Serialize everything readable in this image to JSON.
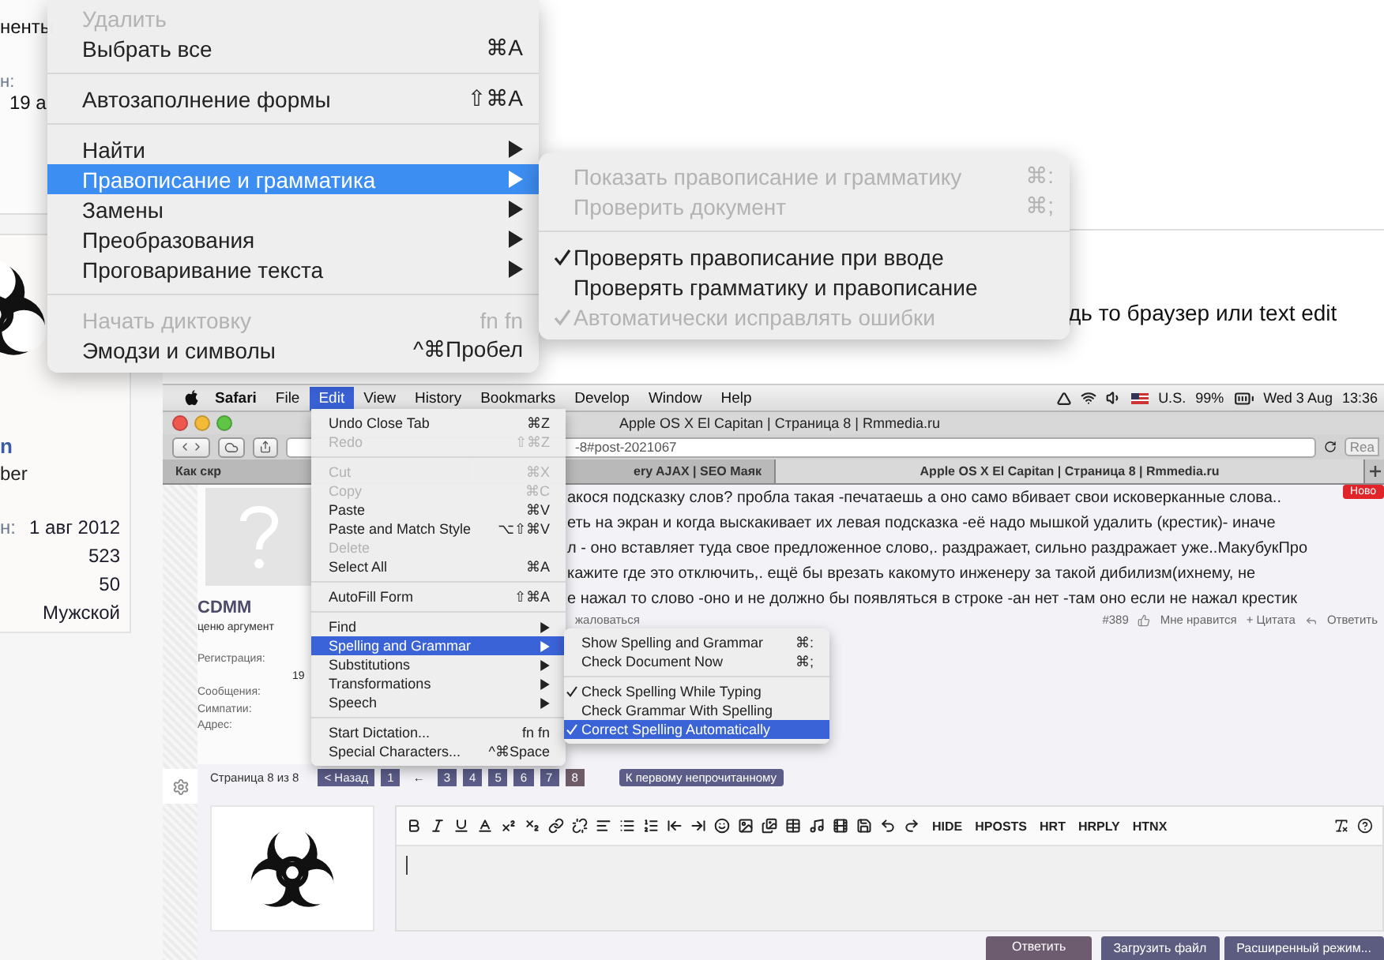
{
  "background_page": {
    "sidebar_fragments": [
      "ненты",
      "н:",
      "19 а"
    ],
    "profile": {
      "name": "n",
      "title": "ber",
      "rows": [
        {
          "label": "н:",
          "value": "1 авг 2012"
        },
        {
          "value": "523"
        },
        {
          "value": "50"
        },
        {
          "value": "Мужской"
        }
      ]
    },
    "post_text": "дь то браузер или text edit"
  },
  "context_menu": {
    "items": [
      {
        "kind": "item",
        "label": "Удалить",
        "disabled": true,
        "selected": false,
        "has_submenu": false
      },
      {
        "kind": "item",
        "label": "Выбрать все",
        "shortcut": "⌘A",
        "disabled": false,
        "selected": false,
        "has_submenu": false
      },
      {
        "kind": "separator"
      },
      {
        "kind": "item",
        "label": "Автозаполнение формы",
        "shortcut": "⇧⌘A",
        "disabled": false,
        "selected": false,
        "has_submenu": false
      },
      {
        "kind": "separator"
      },
      {
        "kind": "item",
        "label": "Найти",
        "disabled": false,
        "selected": false,
        "has_submenu": true
      },
      {
        "kind": "item",
        "label": "Правописание и грамматика",
        "disabled": false,
        "selected": true,
        "has_submenu": true
      },
      {
        "kind": "item",
        "label": "Замены",
        "disabled": false,
        "selected": false,
        "has_submenu": true
      },
      {
        "kind": "item",
        "label": "Преобразования",
        "disabled": false,
        "selected": false,
        "has_submenu": true
      },
      {
        "kind": "item",
        "label": "Проговаривание текста",
        "disabled": false,
        "selected": false,
        "has_submenu": true
      },
      {
        "kind": "separator"
      },
      {
        "kind": "item",
        "label": "Начать диктовку",
        "shortcut": "fn fn",
        "disabled": true,
        "selected": false,
        "has_submenu": false
      },
      {
        "kind": "item",
        "label": "Эмодзи и символы",
        "shortcut": "^⌘Пробел",
        "disabled": false,
        "selected": false,
        "has_submenu": false
      }
    ]
  },
  "submenu": {
    "items": [
      {
        "kind": "item",
        "label": "Показать правописание и грамматику",
        "shortcut": "⌘:",
        "disabled": true,
        "selected": false,
        "checked": false
      },
      {
        "kind": "item",
        "label": "Проверить документ",
        "shortcut": "⌘;",
        "disabled": true,
        "selected": false,
        "checked": false
      },
      {
        "kind": "separator"
      },
      {
        "kind": "item",
        "label": "Проверять правописание при вводе",
        "disabled": false,
        "selected": false,
        "checked": true
      },
      {
        "kind": "item",
        "label": "Проверять грамматику и правописание",
        "disabled": false,
        "selected": false,
        "checked": false
      },
      {
        "kind": "item",
        "label": "Автоматически исправлять ошибки",
        "disabled": true,
        "selected": false,
        "checked": true
      }
    ]
  },
  "embedded_screenshot": {
    "menubar": {
      "items": [
        {
          "label": "Safari",
          "kind": "app",
          "selected": false
        },
        {
          "label": "File",
          "kind": "menu",
          "selected": false
        },
        {
          "label": "Edit",
          "kind": "menu",
          "selected": true
        },
        {
          "label": "View",
          "kind": "menu",
          "selected": false
        },
        {
          "label": "History",
          "kind": "menu",
          "selected": false
        },
        {
          "label": "Bookmarks",
          "kind": "menu",
          "selected": false
        },
        {
          "label": "Develop",
          "kind": "menu",
          "selected": false
        },
        {
          "label": "Window",
          "kind": "menu",
          "selected": false
        },
        {
          "label": "Help",
          "kind": "menu",
          "selected": false
        }
      ],
      "input_source": "U.S.",
      "battery": "99%",
      "date": "Wed 3 Aug",
      "time": "13:36"
    },
    "window": {
      "title": "Apple OS X El Capitan | Страница 8 | Rmmedia.ru",
      "address": "-8#post-2021067",
      "reader": "Rea",
      "tabs": [
        {
          "label": "Как скр",
          "selected": false
        },
        {
          "label": "ery AJAX | SEO Маяк",
          "selected": false
        },
        {
          "label": "Apple OS X El Capitan | Страница 8 | Rmmedia.ru",
          "selected": true
        }
      ]
    },
    "post": {
      "author": "CDMM",
      "author_title": "ценю аргумент",
      "info_labels": [
        "Регистрация:",
        "19",
        "Сообщения:",
        "Симпатии:",
        "Адрес:"
      ],
      "lines": [
        "акося подсказку слов? пробла такая -печатаешь а оно само вбивает свои исковерканные слова..",
        "еть на экран и когда выскакивает их левая подсказка -её надо мышкой удалить (крестик)- иначе",
        "л - оно вставляет туда свое предложенное слово,. раздражает, сильно раздражает уже..МакубукПро",
        "кажите где это отключить,. ещё бы врезать какомуто инженеру за такой дибилизм(ихнему, не",
        "е нажал то слово -оно и не должно бы появляться в строке -ан нет -там оно если не нажал крестик"
      ],
      "report": "жаловаться",
      "number": "#389",
      "like": "Мне нравится",
      "quote": "+ Цитата",
      "reply": "Ответить",
      "badge": "Ново"
    },
    "edit_menu": {
      "items": [
        {
          "kind": "item",
          "label": "Undo Close Tab",
          "shortcut": "⌘Z",
          "disabled": false,
          "selected": false,
          "has_submenu": false
        },
        {
          "kind": "item",
          "label": "Redo",
          "shortcut": "⇧⌘Z",
          "disabled": true,
          "selected": false,
          "has_submenu": false
        },
        {
          "kind": "separator"
        },
        {
          "kind": "item",
          "label": "Cut",
          "shortcut": "⌘X",
          "disabled": true,
          "selected": false,
          "has_submenu": false
        },
        {
          "kind": "item",
          "label": "Copy",
          "shortcut": "⌘C",
          "disabled": true,
          "selected": false,
          "has_submenu": false
        },
        {
          "kind": "item",
          "label": "Paste",
          "shortcut": "⌘V",
          "disabled": false,
          "selected": false,
          "has_submenu": false
        },
        {
          "kind": "item",
          "label": "Paste and Match Style",
          "shortcut": "⌥⇧⌘V",
          "disabled": false,
          "selected": false,
          "has_submenu": false
        },
        {
          "kind": "item",
          "label": "Delete",
          "disabled": true,
          "selected": false,
          "has_submenu": false
        },
        {
          "kind": "item",
          "label": "Select All",
          "shortcut": "⌘A",
          "disabled": false,
          "selected": false,
          "has_submenu": false
        },
        {
          "kind": "separator"
        },
        {
          "kind": "item",
          "label": "AutoFill Form",
          "shortcut": "⇧⌘A",
          "disabled": false,
          "selected": false,
          "has_submenu": false
        },
        {
          "kind": "separator"
        },
        {
          "kind": "item",
          "label": "Find",
          "disabled": false,
          "selected": false,
          "has_submenu": true
        },
        {
          "kind": "item",
          "label": "Spelling and Grammar",
          "disabled": false,
          "selected": true,
          "has_submenu": true
        },
        {
          "kind": "item",
          "label": "Substitutions",
          "disabled": false,
          "selected": false,
          "has_submenu": true
        },
        {
          "kind": "item",
          "label": "Transformations",
          "disabled": false,
          "selected": false,
          "has_submenu": true
        },
        {
          "kind": "item",
          "label": "Speech",
          "disabled": false,
          "selected": false,
          "has_submenu": true
        },
        {
          "kind": "separator"
        },
        {
          "kind": "item",
          "label": "Start Dictation...",
          "shortcut": "fn fn",
          "disabled": false,
          "selected": false,
          "has_submenu": false
        },
        {
          "kind": "item",
          "label": "Special Characters...",
          "shortcut": "^⌘Space",
          "disabled": false,
          "selected": false,
          "has_submenu": false
        }
      ]
    },
    "spelling_submenu": {
      "items": [
        {
          "kind": "item",
          "label": "Show Spelling and Grammar",
          "shortcut": "⌘:",
          "disabled": false,
          "selected": false,
          "checked": false
        },
        {
          "kind": "item",
          "label": "Check Document Now",
          "shortcut": "⌘;",
          "disabled": false,
          "selected": false,
          "checked": false
        },
        {
          "kind": "separator"
        },
        {
          "kind": "item",
          "label": "Check Spelling While Typing",
          "disabled": false,
          "selected": false,
          "checked": true
        },
        {
          "kind": "item",
          "label": "Check Grammar With Spelling",
          "disabled": false,
          "selected": false,
          "checked": false
        },
        {
          "kind": "item",
          "label": "Correct Spelling Automatically",
          "disabled": false,
          "selected": true,
          "checked": true
        }
      ]
    },
    "pagination": {
      "label": "Страница 8 из 8",
      "pages": [
        {
          "label": "< Назад",
          "kind": "page",
          "selected": false
        },
        {
          "label": "1",
          "kind": "page",
          "selected": false
        },
        {
          "label": "←",
          "kind": "gap"
        },
        {
          "label": "3",
          "kind": "page",
          "selected": false
        },
        {
          "label": "4",
          "kind": "page",
          "selected": false
        },
        {
          "label": "5",
          "kind": "page",
          "selected": false
        },
        {
          "label": "6",
          "kind": "page",
          "selected": false
        },
        {
          "label": "7",
          "kind": "page",
          "selected": false
        },
        {
          "label": "8",
          "kind": "page",
          "selected": true
        }
      ],
      "unread": "К первому непрочитанному"
    },
    "editor": {
      "tools": [
        "HIDE",
        "HPOSTS",
        "HRT",
        "HRPLY",
        "HTNX"
      ]
    },
    "buttons": [
      {
        "label": "Ответить",
        "kind": "primary"
      },
      {
        "label": "Загрузить файл",
        "kind": "secondary"
      },
      {
        "label": "Расширенный режим...",
        "kind": "secondary"
      }
    ]
  }
}
